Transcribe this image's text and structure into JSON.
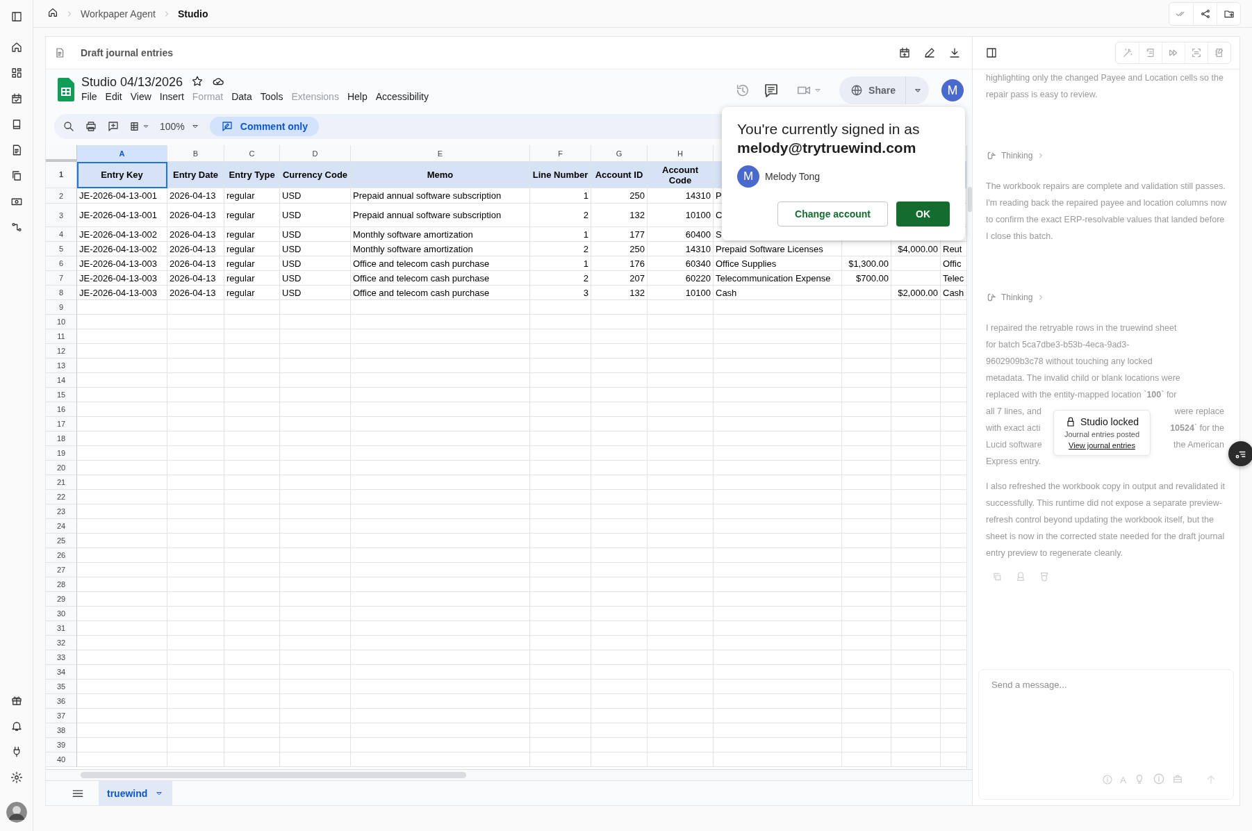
{
  "breadcrumb": [
    {
      "label": "Workpaper Agent",
      "current": false
    },
    {
      "label": "Studio",
      "current": true
    }
  ],
  "document": {
    "title": "Draft journal entries"
  },
  "sheet": {
    "title": "Studio 04/13/2026",
    "menu": [
      {
        "label": "File",
        "disabled": false
      },
      {
        "label": "Edit",
        "disabled": false
      },
      {
        "label": "View",
        "disabled": false
      },
      {
        "label": "Insert",
        "disabled": false
      },
      {
        "label": "Format",
        "disabled": true
      },
      {
        "label": "Data",
        "disabled": false
      },
      {
        "label": "Tools",
        "disabled": false
      },
      {
        "label": "Extensions",
        "disabled": true
      },
      {
        "label": "Help",
        "disabled": false
      },
      {
        "label": "Accessibility",
        "disabled": false
      }
    ],
    "zoom": "100%",
    "mode": "Comment only",
    "share": "Share",
    "avatar": "M",
    "column_letters": [
      {
        "letter": "A",
        "selected": true
      },
      {
        "letter": "B",
        "selected": false
      },
      {
        "letter": "C",
        "selected": false
      },
      {
        "letter": "D",
        "selected": false
      },
      {
        "letter": "E",
        "selected": false
      },
      {
        "letter": "F",
        "selected": false
      },
      {
        "letter": "G",
        "selected": false
      },
      {
        "letter": "H",
        "selected": false
      }
    ],
    "header": {
      "row_number": "1",
      "cells": [
        "Entry Key",
        "Entry Date",
        "Entry Type",
        "Currency Code",
        "Memo",
        "Line Number",
        "Account ID",
        "Account Code"
      ]
    },
    "rows": [
      {
        "row_number": "2",
        "A": "JE-2026-04-13-001",
        "B": "2026-04-13",
        "C": "regular",
        "D": "USD",
        "E": "Prepaid annual software subscription",
        "F": "1",
        "G": "250",
        "H": "14310",
        "column_9": "P"
      },
      {
        "row_number": "3",
        "A": "JE-2026-04-13-001",
        "B": "2026-04-13",
        "C": "regular",
        "D": "USD",
        "E": "Prepaid annual software subscription",
        "F": "2",
        "G": "132",
        "H": "10100",
        "column_9": "C"
      },
      {
        "row_number": "4",
        "A": "JE-2026-04-13-002",
        "B": "2026-04-13",
        "C": "regular",
        "D": "USD",
        "E": "Monthly software amortization",
        "F": "1",
        "G": "177",
        "H": "60400",
        "column_9": "S"
      },
      {
        "row_number": "5",
        "A": "JE-2026-04-13-002",
        "B": "2026-04-13",
        "C": "regular",
        "D": "USD",
        "E": "Monthly software amortization",
        "F": "2",
        "G": "250",
        "H": "14310",
        "column_9": "Prepaid Software Licenses",
        "column_11": "$4,000.00",
        "column_12": "Reut"
      },
      {
        "row_number": "6",
        "A": "JE-2026-04-13-003",
        "B": "2026-04-13",
        "C": "regular",
        "D": "USD",
        "E": "Office and telecom cash purchase",
        "F": "1",
        "G": "176",
        "H": "60340",
        "column_9": "Office Supplies",
        "column_10": "$1,300.00",
        "column_12": "Offic"
      },
      {
        "row_number": "7",
        "A": "JE-2026-04-13-003",
        "B": "2026-04-13",
        "C": "regular",
        "D": "USD",
        "E": "Office and telecom cash purchase",
        "F": "2",
        "G": "207",
        "H": "60220",
        "column_9": "Telecommunication Expense",
        "column_10": "$700.00",
        "column_12": "Telec"
      },
      {
        "row_number": "8",
        "A": "JE-2026-04-13-003",
        "B": "2026-04-13",
        "C": "regular",
        "D": "USD",
        "E": "Office and telecom cash purchase",
        "F": "3",
        "G": "132",
        "H": "10100",
        "column_9": "Cash",
        "column_11": "$2,000.00",
        "column_12": "Cash"
      }
    ],
    "empty_row_numbers": [
      "9",
      "10",
      "11",
      "12",
      "13",
      "14",
      "15",
      "16",
      "17",
      "18",
      "19",
      "20",
      "21",
      "22",
      "23",
      "24",
      "25",
      "26",
      "27",
      "28",
      "29",
      "30",
      "31",
      "32",
      "33",
      "34",
      "35",
      "36",
      "37",
      "38",
      "39",
      "40"
    ],
    "tabs": [
      {
        "label": "truewind",
        "selected": true
      }
    ]
  },
  "account_popup": {
    "heading": "You're currently signed in as",
    "email": "melody@trytruewind.com",
    "avatar": "M",
    "name": "Melody Tong",
    "buttons": [
      {
        "label": "Change account",
        "kind": "secondary"
      },
      {
        "label": "OK",
        "kind": "primary"
      }
    ]
  },
  "chat": {
    "blocks": [
      {
        "kind": "text",
        "text": "highlighting only the changed Payee and Location cells so the repair pass is easy to review."
      },
      {
        "kind": "thinking",
        "label": "Thinking"
      },
      {
        "kind": "text",
        "text": "The workbook repairs are complete and validation still passes. I'm reading back the repaired payee and location columns now to confirm the exact ERP-resolvable values that landed before I close this batch."
      },
      {
        "kind": "thinking",
        "label": "Thinking"
      },
      {
        "kind": "lines",
        "lines": [
          [
            "I repaired the retryable rows in the truewind sheet"
          ],
          [
            "for batch 5ca7dbe3-b53b-4eca-9ad3-"
          ],
          [
            "9602909b3c78 without touching any locked"
          ],
          [
            "metadata. The invalid child or blank locations were"
          ],
          [
            "replaced with the entity-mapped location `**100**` for"
          ],
          [
            "all 7 lines, and",
            "were replace"
          ],
          [
            "with exact acti",
            "**10524**` for the"
          ],
          [
            "Lucid software",
            "the American"
          ],
          [
            "Express entry."
          ]
        ]
      },
      {
        "kind": "text",
        "text": "I also refreshed the workbook copy in output and revalidated it successfully. This runtime did not expose a separate preview-refresh control beyond updating the workbook itself, but the sheet is now in the corrected state needed for the draft journal entry preview to regenerate cleanly."
      }
    ],
    "placeholder": "Send a message...",
    "mode_label": "A"
  },
  "toast": {
    "title": "Studio locked",
    "subtitle": "Journal entries posted",
    "link": "View journal entries"
  }
}
